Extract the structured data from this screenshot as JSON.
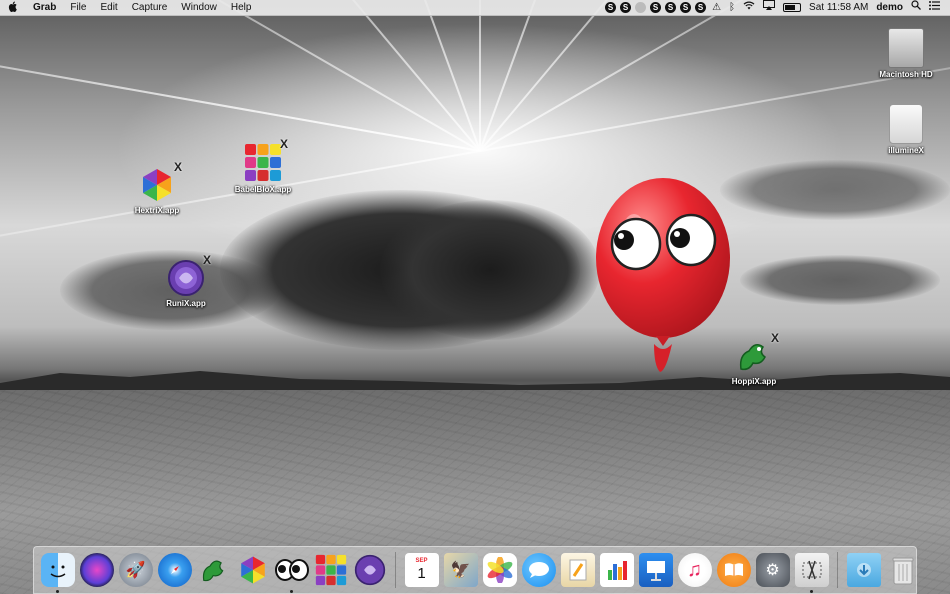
{
  "menubar": {
    "apple_icon": "apple-icon",
    "app_name": "Grab",
    "menus": [
      "File",
      "Edit",
      "Capture",
      "Window",
      "Help"
    ],
    "clock": "Sat 11:58 AM",
    "user": "demo",
    "status_glyph": "S"
  },
  "desktop": {
    "icons": {
      "macintosh_hd": "Macintosh HD",
      "illuminex": "illumineX",
      "hextrix": "HextriX.app",
      "babelblox": "BabelBloX.app",
      "runix": "RuniX.app",
      "hoppix": "HoppiX.app"
    },
    "badge": "X"
  },
  "dock": {
    "calendar_month": "SEP",
    "calendar_day": "1"
  },
  "colors": {
    "balloon": "#e8262f",
    "menubar": "#ebebeb"
  }
}
